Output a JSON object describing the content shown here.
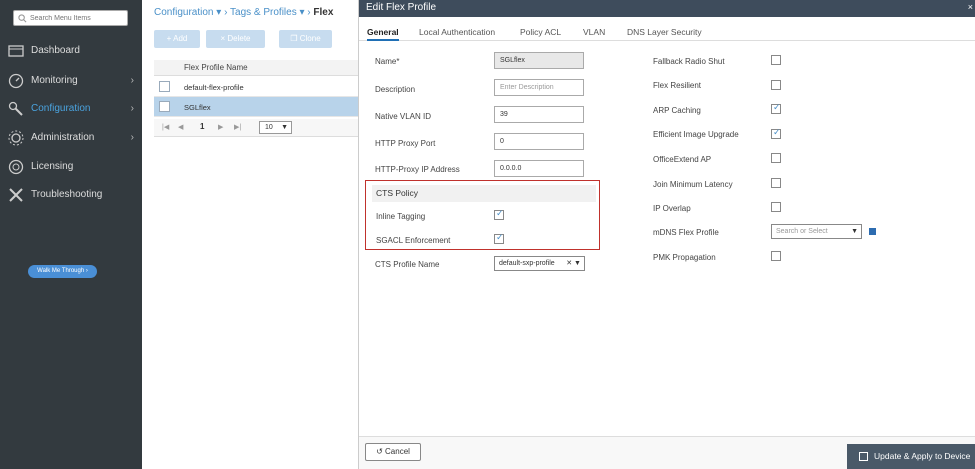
{
  "sidebar": {
    "search_placeholder": "Search Menu Items",
    "items": [
      {
        "label": "Dashboard",
        "icon": "dashboard-icon",
        "chevron": false,
        "active": false
      },
      {
        "label": "Monitoring",
        "icon": "monitoring-icon",
        "chevron": true,
        "active": false
      },
      {
        "label": "Configuration",
        "icon": "configuration-icon",
        "chevron": true,
        "active": true
      },
      {
        "label": "Administration",
        "icon": "administration-icon",
        "chevron": true,
        "active": false
      },
      {
        "label": "Licensing",
        "icon": "licensing-icon",
        "chevron": false,
        "active": false
      },
      {
        "label": "Troubleshooting",
        "icon": "troubleshooting-icon",
        "chevron": false,
        "active": false
      }
    ],
    "walk_me_label": "Walk Me Through ›"
  },
  "breadcrumb": {
    "item1": "Configuration",
    "item2": "Tags & Profiles",
    "current": "Flex"
  },
  "list": {
    "add_label": "+ Add",
    "delete_label": "× Delete",
    "clone_label": "Clone",
    "column_header": "Flex Profile Name",
    "rows": [
      "default-flex-profile",
      "SGLflex"
    ],
    "page": "1",
    "page_size": "10"
  },
  "modal": {
    "title": "Edit Flex Profile",
    "close": "×",
    "tabs": [
      "General",
      "Local Authentication",
      "Policy ACL",
      "VLAN",
      "DNS Layer Security"
    ],
    "left": {
      "name_label": "Name*",
      "name_value": "SGLflex",
      "description_label": "Description",
      "description_placeholder": "Enter Description",
      "native_vlan_label": "Native VLAN ID",
      "native_vlan_value": "39",
      "http_proxy_port_label": "HTTP Proxy Port",
      "http_proxy_port_value": "0",
      "http_proxy_ip_label": "HTTP-Proxy IP Address",
      "http_proxy_ip_value": "0.0.0.0",
      "cts_policy_title": "CTS Policy",
      "inline_tagging_label": "Inline Tagging",
      "sgacl_label": "SGACL Enforcement",
      "cts_profile_label": "CTS Profile Name",
      "cts_profile_value": "default-sxp-profile"
    },
    "right": {
      "items": [
        {
          "label": "Fallback Radio Shut",
          "checked": false
        },
        {
          "label": "Flex Resilient",
          "checked": false
        },
        {
          "label": "ARP Caching",
          "checked": true
        },
        {
          "label": "Efficient Image Upgrade",
          "checked": true
        },
        {
          "label": "OfficeExtend AP",
          "checked": false
        },
        {
          "label": "Join Minimum Latency",
          "checked": false
        },
        {
          "label": "IP Overlap",
          "checked": false
        }
      ],
      "mdns_label": "mDNS Flex Profile",
      "mdns_placeholder": "Search or Select",
      "pmk_label": "PMK Propagation"
    },
    "cancel_label": "Cancel",
    "update_label": "Update & Apply to Device"
  },
  "colors": {
    "sidebar_bg": "#333a3f",
    "accent": "#4a90c8",
    "highlight_border": "#c0312c",
    "modal_header": "#3e4c5c"
  }
}
